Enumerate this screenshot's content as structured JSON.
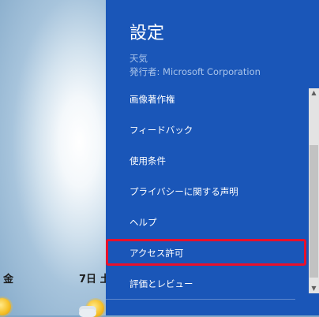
{
  "weather": {
    "day_left": "金",
    "day_right": "7日 土"
  },
  "settings": {
    "title": "設定",
    "app_name": "天気",
    "publisher": "発行者: Microsoft Corporation",
    "items": [
      {
        "label": "画像著作権"
      },
      {
        "label": "フィードバック"
      },
      {
        "label": "使用条件"
      },
      {
        "label": "プライバシーに関する声明"
      },
      {
        "label": "ヘルプ"
      },
      {
        "label": "アクセス許可",
        "highlighted": true
      },
      {
        "label": "評価とレビュー"
      }
    ]
  },
  "colors": {
    "panel": "#1a56b8",
    "highlight": "#e8102b"
  },
  "icons": [
    "sun-icon",
    "cloud-icon",
    "scroll-up-arrow-icon",
    "scroll-down-arrow-icon"
  ]
}
